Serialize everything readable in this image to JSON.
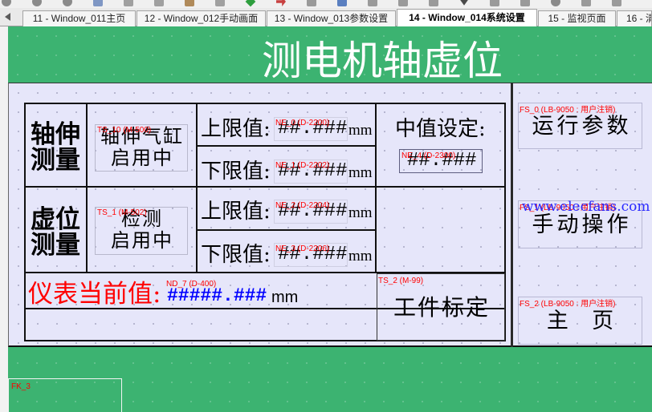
{
  "toolbar": {
    "icons": [
      {
        "name": "circle-icon",
        "color": "#8a8a8a"
      },
      {
        "name": "circle-icon",
        "color": "#8a8a8a"
      },
      {
        "name": "circle-icon",
        "color": "#8a8a8a"
      },
      {
        "name": "square-icon",
        "color": "#7f97c4"
      },
      {
        "name": "square-icon",
        "color": "#a0a0a0"
      },
      {
        "name": "square-icon",
        "color": "#a0a0a0"
      },
      {
        "name": "square-icon",
        "color": "#b08a5a"
      },
      {
        "name": "square-icon",
        "color": "#a0a0a0"
      },
      {
        "name": "diamond-icon",
        "color": "#2e9e3e"
      },
      {
        "name": "arrow-icon",
        "color": "#c84040"
      },
      {
        "name": "square-icon",
        "color": "#9a9a9a"
      },
      {
        "name": "square-icon",
        "color": "#5a7fc0"
      },
      {
        "name": "square-icon",
        "color": "#9a9a9a"
      },
      {
        "name": "square-icon",
        "color": "#9a9a9a"
      },
      {
        "name": "square-icon",
        "color": "#9a9a9a"
      },
      {
        "name": "chevron-down-icon",
        "color": "#4a4a4a"
      },
      {
        "name": "square-icon",
        "color": "#9a9a9a"
      },
      {
        "name": "square-icon",
        "color": "#9a9a9a"
      },
      {
        "name": "circle-icon",
        "color": "#8a8a8a"
      },
      {
        "name": "square-icon",
        "color": "#9a9a9a"
      },
      {
        "name": "square-icon",
        "color": "#9a9a9a"
      }
    ]
  },
  "tabs": {
    "items": [
      {
        "label": "11 - Window_011主页",
        "active": false
      },
      {
        "label": "12 - Window_012手动画面",
        "active": false
      },
      {
        "label": "13 - Window_013参数设置",
        "active": false
      },
      {
        "label": "14 - Window_014系统设置",
        "active": true
      },
      {
        "label": "15 - 监视页面",
        "active": false
      },
      {
        "label": "16 - 清",
        "active": false
      }
    ]
  },
  "colors": {
    "canvas_green": "#3cb371",
    "panel_lavender": "#e6e6fa",
    "tag_red": "#ff0000",
    "meter_label_red": "#ff0000",
    "meter_value_blue": "#0000ff",
    "title_white": "#ffffff",
    "watermark_blue": "#2a2aff"
  },
  "screen": {
    "title": "测电机轴虚位",
    "shaft": {
      "label_line1": "轴伸",
      "label_line2": "测量",
      "status": {
        "tag": "TS_10 (M-500)",
        "line1": "轴伸气缸",
        "line2": "启用中"
      },
      "upper": {
        "label": "上限值:",
        "tag": "NE_0 (D-2200)",
        "value": "##.###",
        "unit": "mm"
      },
      "lower": {
        "label": "下限值:",
        "tag": "NE_1 (D-2202)",
        "value": "##.###",
        "unit": "mm"
      },
      "mid": {
        "label": "中值设定:",
        "tag": "NE_4 (D-2300)",
        "value": "##.###"
      }
    },
    "play": {
      "label_line1": "虚位",
      "label_line2": "测量",
      "status": {
        "tag": "TS_1 (M-502)",
        "line1": "检测",
        "line2": "启用中"
      },
      "upper": {
        "label": "上限值:",
        "tag": "NE_2 (D-2204)",
        "value": "##.###",
        "unit": "mm"
      },
      "lower": {
        "label": "下限值:",
        "tag": "NE_3 (D-2206)",
        "value": "##.###",
        "unit": "mm"
      }
    },
    "meter": {
      "label": "仪表当前值:",
      "tag": "ND_7 (D-400)",
      "value": "#####.###",
      "unit": "mm"
    },
    "calibrate": {
      "tag": "TS_2 (M-99)",
      "label": "工件标定"
    },
    "nav": [
      {
        "tag": "FS_0 (LB-9050 : 用户注销)",
        "label": "运行参数"
      },
      {
        "tag": "FS_1 (LB-9050 : 用户注销)",
        "label": "手动操作"
      },
      {
        "tag": "FS_2 (LB-9050 : 用户注销)",
        "label": "主  页"
      }
    ],
    "frame": {
      "tag": "FK_3"
    }
  },
  "watermark": "www.elecfans.com"
}
